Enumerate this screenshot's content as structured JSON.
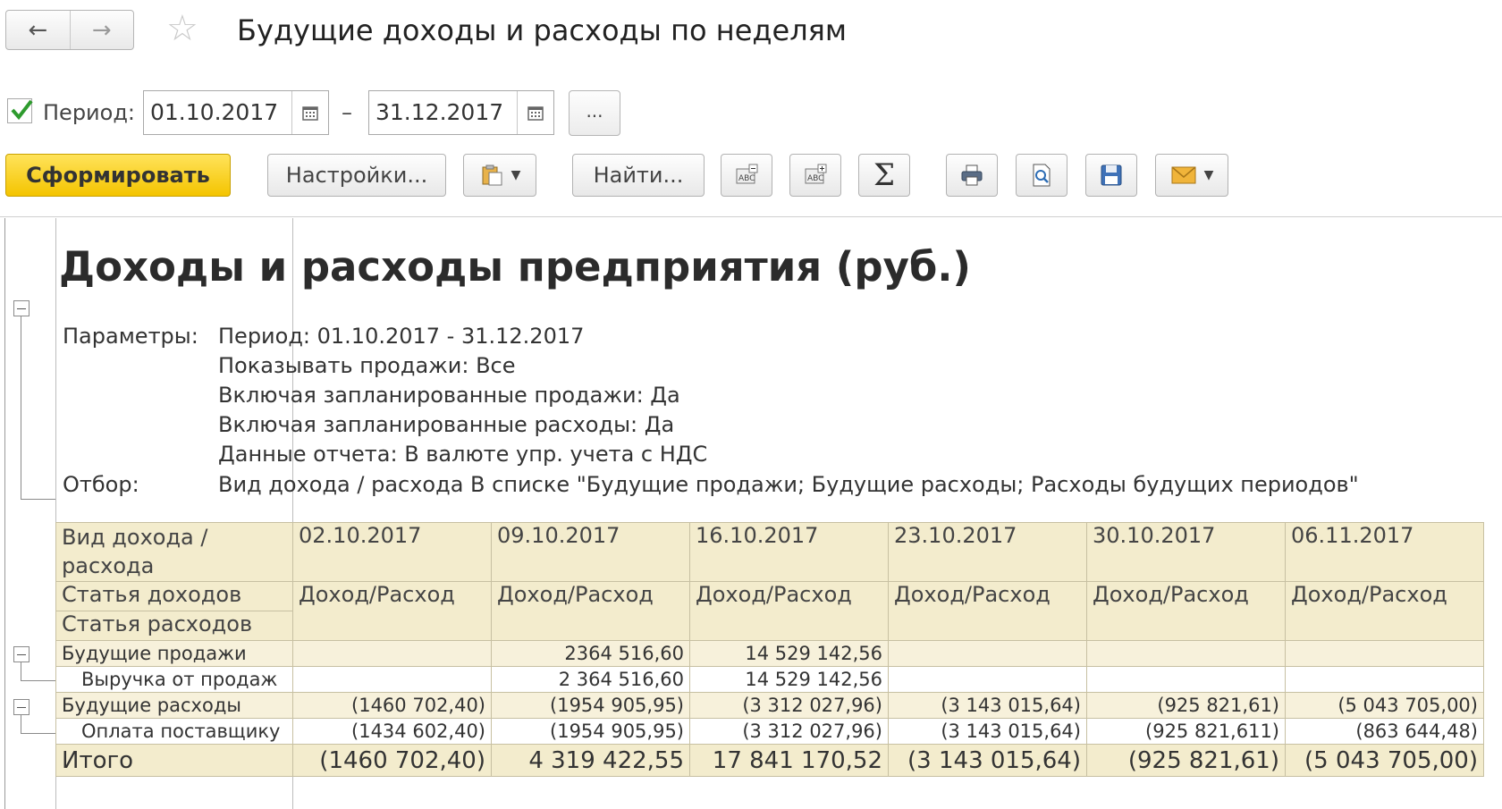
{
  "window": {
    "title": "Будущие доходы и расходы по неделям"
  },
  "filters": {
    "period_checked": true,
    "period_label": "Период:",
    "date_from": "01.10.2017",
    "date_separator": "–",
    "date_to": "31.12.2017",
    "more_button": "..."
  },
  "toolbar": {
    "generate": "Сформировать",
    "settings": "Настройки...",
    "find": "Найти..."
  },
  "report": {
    "title": "Доходы и расходы предприятия (руб.)",
    "params_label": "Параметры:",
    "params": [
      "Период: 01.10.2017 - 31.12.2017",
      "Показывать продажи: Все",
      "Включая запланированные продажи: Да",
      "Включая запланированные расходы: Да",
      "Данные отчета: В валюте упр. учета с НДС"
    ],
    "filter_label": "Отбор:",
    "filter_value": "Вид дохода / расхода В списке \"Будущие продажи; Будущие расходы; Расходы будущих периодов\"",
    "table": {
      "row_header_1": "Вид дохода / расхода",
      "row_header_2": "Статья доходов",
      "row_header_3": "Статья расходов",
      "dates": [
        "02.10.2017",
        "09.10.2017",
        "16.10.2017",
        "23.10.2017",
        "30.10.2017",
        "06.11.2017"
      ],
      "measure": "Доход/Расход",
      "rows": [
        {
          "label": "Будущие продажи",
          "values": [
            "",
            "2364 516,60",
            "14 529 142,56",
            "",
            "",
            ""
          ]
        },
        {
          "label": "Выручка от продаж",
          "values": [
            "",
            "2 364 516,60",
            "14 529 142,56",
            "",
            "",
            ""
          ]
        },
        {
          "label": "Будущие расходы",
          "values": [
            "(1460 702,40)",
            "(1954 905,95)",
            "(3 312 027,96)",
            "(3 143 015,64)",
            "(925 821,61)",
            "(5 043 705,00)"
          ]
        },
        {
          "label": "Оплата поставщику",
          "values": [
            "(1434 602,40)",
            "(1954 905,95)",
            "(3 312 027,96)",
            "(3 143 015,64)",
            "(925 821,611)",
            "(863 644,48)"
          ]
        }
      ],
      "total": {
        "label": "Итого",
        "values": [
          "(1460 702,40)",
          "4 319 422,55",
          "17 841 170,52",
          "(3 143 015,64)",
          "(925 821,61)",
          "(5 043 705,00)"
        ]
      }
    }
  },
  "colors": {
    "accent": "#f4c400",
    "table_header": "#f3eccd",
    "table_group": "#f7f1db"
  }
}
